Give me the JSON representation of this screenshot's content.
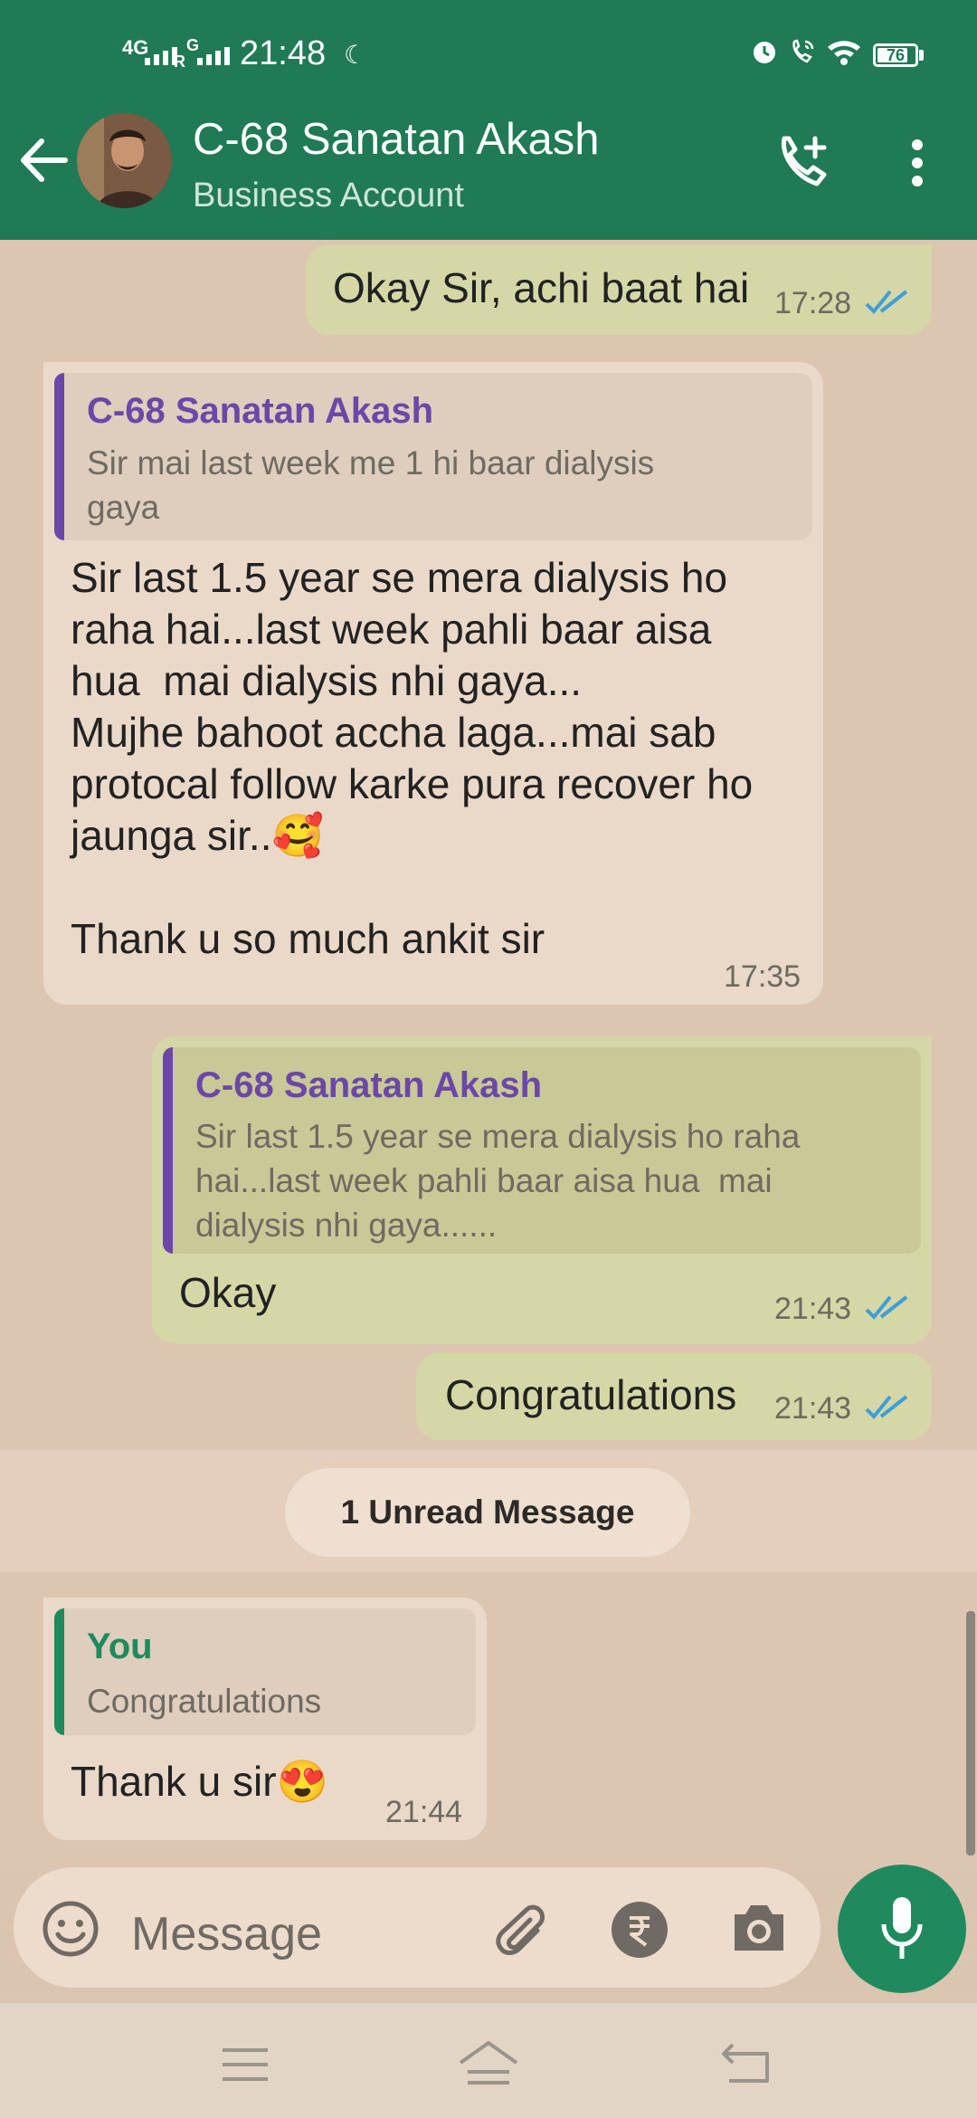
{
  "status_bar": {
    "network_1": "4G",
    "network_2": "R",
    "network_2_sup": "G",
    "time": "21:48",
    "battery": "76"
  },
  "header": {
    "title": "C-68 Sanatan Akash",
    "subtitle": "Business Account",
    "icons": [
      "back-arrow-icon",
      "avatar",
      "add-call-icon",
      "more-vert-icon"
    ]
  },
  "messages": [
    {
      "id": "m1",
      "direction": "out",
      "text": "Okay Sir, achi baat hai",
      "time": "17:28",
      "read": true
    },
    {
      "id": "m2",
      "direction": "in",
      "quote": {
        "name": "C-68 Sanatan Akash",
        "text": "Sir mai last week me 1 hi baar dialysis\ngaya"
      },
      "text": "Sir last 1.5 year se mera dialysis ho\nraha hai...last week pahli baar aisa\nhua  mai dialysis nhi gaya...\nMujhe bahoot accha laga...mai sab\nprotocal follow karke pura recover ho\njaunga sir..🥰\n\nThank u so much ankit sir",
      "time": "17:35"
    },
    {
      "id": "m3",
      "direction": "out",
      "quote": {
        "name": "C-68 Sanatan Akash",
        "text": "Sir last 1.5 year se mera dialysis ho raha\nhai...last week pahli baar aisa hua  mai\ndialysis nhi gaya......"
      },
      "text": "Okay",
      "time": "21:43",
      "read": true
    },
    {
      "id": "m4",
      "direction": "out",
      "text": "Congratulations",
      "time": "21:43",
      "read": true
    },
    {
      "id": "m5",
      "direction": "in",
      "quote": {
        "name": "You",
        "text": "Congratulations"
      },
      "text": "Thank u sir😍",
      "time": "21:44"
    }
  ],
  "unread_divider": "1 Unread Message",
  "composer": {
    "placeholder": "Message",
    "icons": [
      "emoji-icon",
      "attach-icon",
      "rupee-icon",
      "camera-icon",
      "mic-icon"
    ]
  },
  "colors": {
    "header": "#1f7a55",
    "outgoing": "#d6d7a6",
    "incoming": "#ead8c8",
    "quote_name_contact": "#6b47a8",
    "quote_name_you": "#1f8a5e",
    "read_ticks": "#3d9ed8"
  }
}
